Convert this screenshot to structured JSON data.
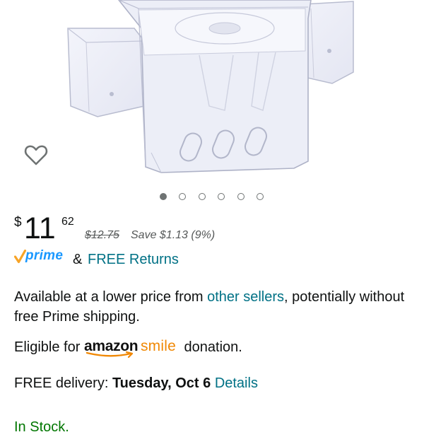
{
  "product": {
    "image_alt": "Clear plastic caddy with side pockets",
    "wishlist_icon": "heart-outline-icon",
    "carousel": {
      "count": 6,
      "active_index": 0
    }
  },
  "price": {
    "symbol": "$",
    "whole": "11",
    "fraction": "62",
    "list_price": "$12.75",
    "savings": "Save $1.13 (9%)"
  },
  "prime": {
    "logo_text": "prime",
    "ampersand": "&",
    "free_returns": "FREE Returns"
  },
  "offers": {
    "lower_price_prefix": "Available at a lower price from ",
    "other_sellers_link": "other sellers",
    "lower_price_suffix": ", potentially without free Prime shipping."
  },
  "smile": {
    "prefix": "Eligible for",
    "logo_amazon": "amazon",
    "logo_smile": "smile",
    "suffix": "donation."
  },
  "delivery": {
    "prefix": "FREE delivery: ",
    "date": "Tuesday, Oct 6",
    "details_link": "Details"
  },
  "stock": {
    "status": "In Stock."
  },
  "colors": {
    "link": "#007185",
    "prime_blue": "#1a98ff",
    "prime_check": "#f7a427",
    "smile_orange": "#f08804",
    "in_stock": "#007600"
  }
}
